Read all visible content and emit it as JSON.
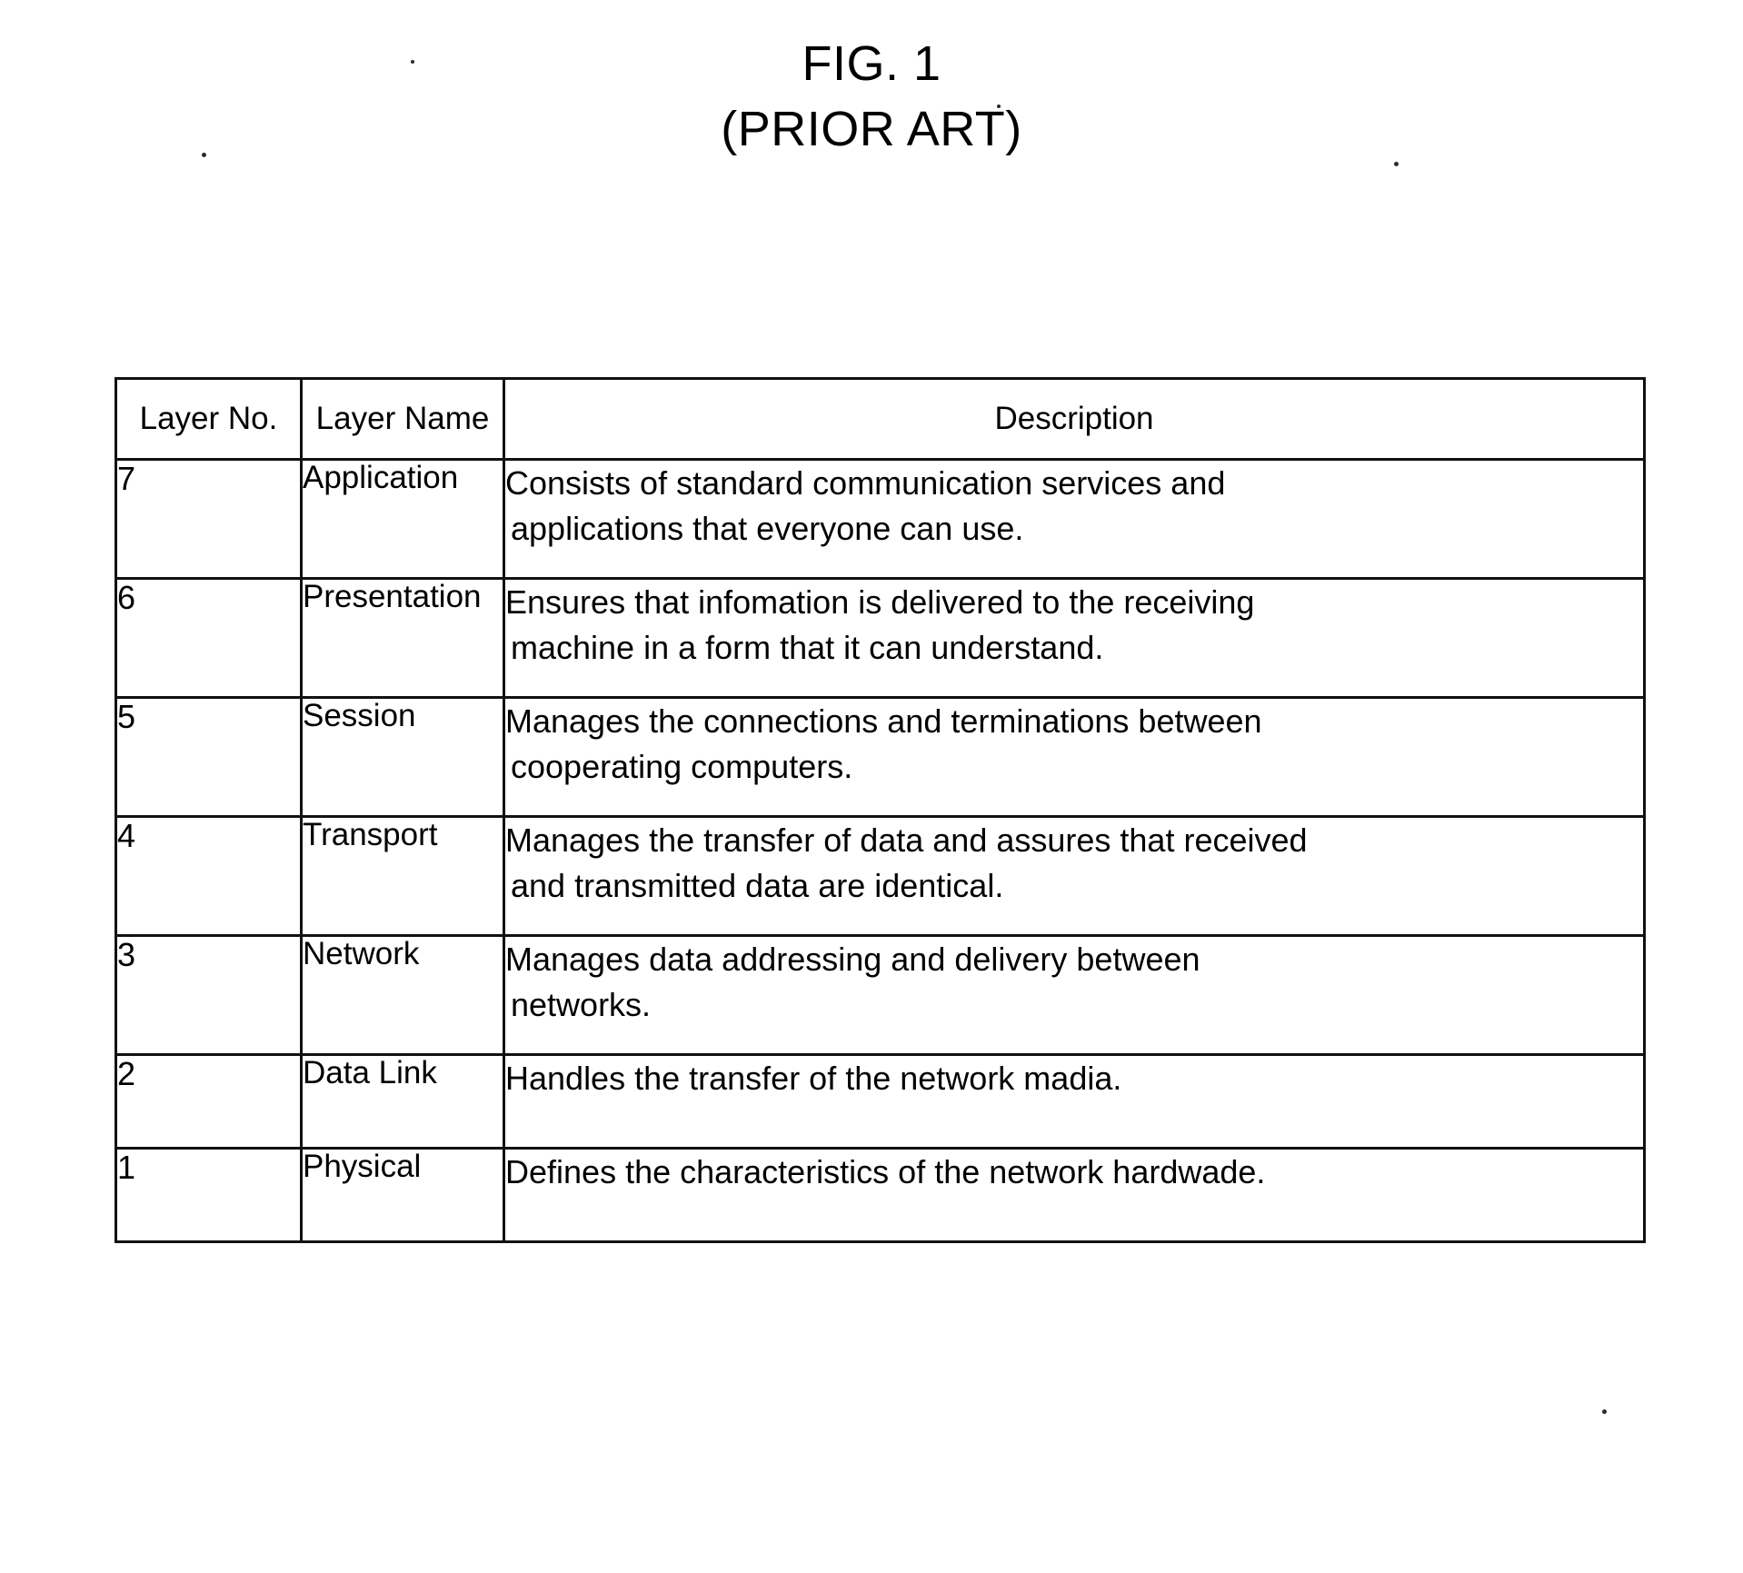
{
  "figure": {
    "number_label": "FIG. 1",
    "prior_art_label": "(PRIOR ART)"
  },
  "table": {
    "headers": {
      "layer_no": "Layer No.",
      "layer_name": "Layer Name",
      "description": "Description"
    },
    "rows": [
      {
        "no": "7",
        "name": "Application",
        "desc_line1": "Consists of standard communication services and",
        "desc_line2": "applications that everyone can use."
      },
      {
        "no": "6",
        "name": "Presentation",
        "desc_line1": "Ensures that infomation is delivered to the receiving",
        "desc_line2": "machine in a form that it can understand."
      },
      {
        "no": "5",
        "name": "Session",
        "desc_line1": "Manages the connections and terminations between",
        "desc_line2": "cooperating computers."
      },
      {
        "no": "4",
        "name": "Transport",
        "desc_line1": "Manages the transfer of data and assures that received",
        "desc_line2": "and transmitted data are identical."
      },
      {
        "no": "3",
        "name": "Network",
        "desc_line1": "Manages data addressing and delivery between",
        "desc_line2": "networks."
      },
      {
        "no": "2",
        "name": "Data Link",
        "desc_line1": "Handles the transfer of the network madia.",
        "desc_line2": ""
      },
      {
        "no": "1",
        "name": "Physical",
        "desc_line1": "Defines the characteristics of the network hardwade.",
        "desc_line2": ""
      }
    ]
  }
}
